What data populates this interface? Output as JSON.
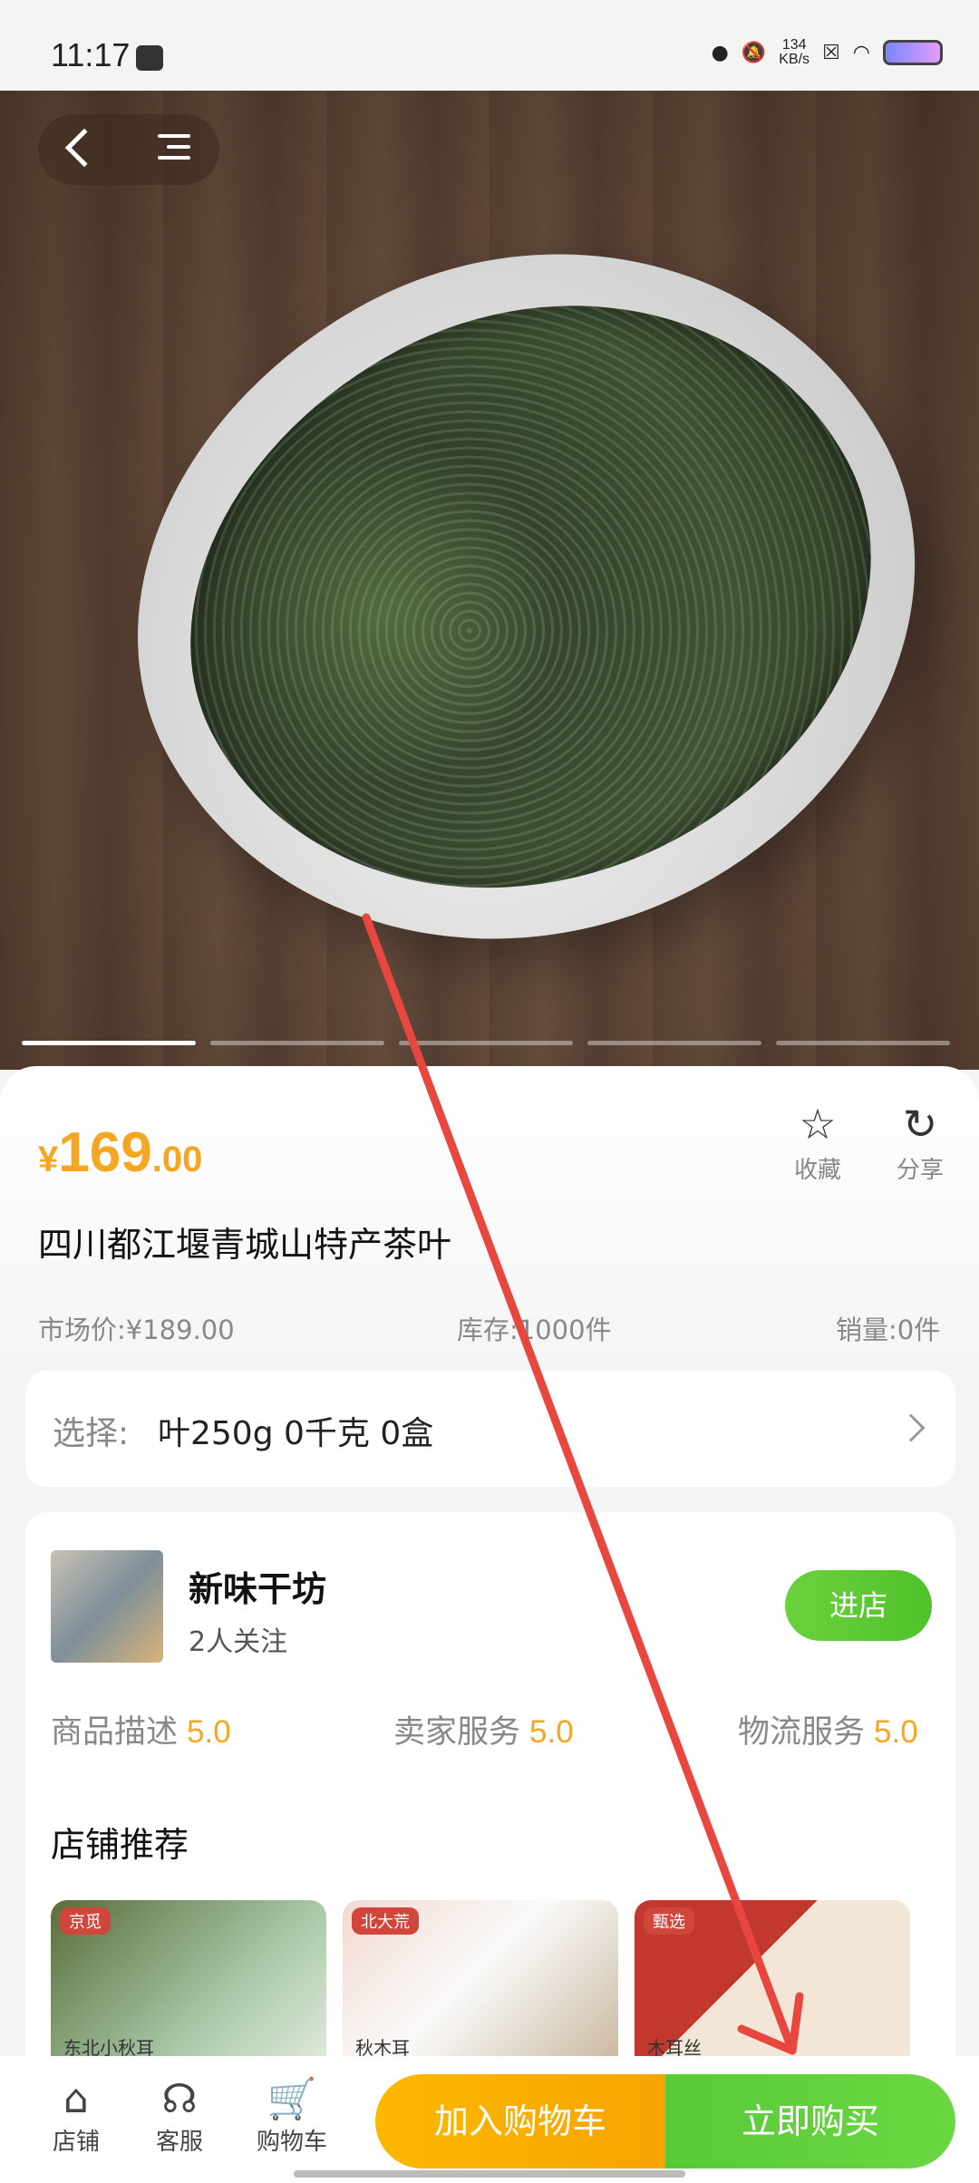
{
  "status_bar": {
    "time": "11:17",
    "net_speed_value": "134",
    "net_speed_unit": "KB/s"
  },
  "product": {
    "price_symbol": "¥",
    "price_integer": "169",
    "price_decimal": ".00",
    "title": "四川都江堰青城山特产茶叶",
    "market_price": "市场价:¥189.00",
    "stock": "库存:1000件",
    "sales": "销量:0件",
    "favorite_label": "收藏",
    "share_label": "分享",
    "image_count": 5,
    "current_image": 1
  },
  "spec": {
    "label": "选择:",
    "value": "叶250g 0千克 0盒"
  },
  "shop": {
    "name": "新味干坊",
    "followers": "2人关注",
    "enter_label": "进店",
    "ratings": [
      {
        "label": "商品描述",
        "score": "5.0"
      },
      {
        "label": "卖家服务",
        "score": "5.0"
      },
      {
        "label": "物流服务",
        "score": "5.0"
      }
    ],
    "recommend_title": "店铺推荐",
    "recommend_items": [
      {
        "tag": "京觅",
        "text": "东北小秋耳"
      },
      {
        "tag": "北大荒",
        "text": "秋木耳"
      },
      {
        "tag": "甄选",
        "text": "木耳丝"
      }
    ]
  },
  "bottom_bar": {
    "shop_label": "店铺",
    "service_label": "客服",
    "cart_label": "购物车",
    "add_cart_label": "加入购物车",
    "buy_now_label": "立即购买"
  },
  "colors": {
    "price": "#f5a623",
    "green": "#59c938",
    "orange": "#fbb800",
    "annotation": "#e8473f"
  }
}
